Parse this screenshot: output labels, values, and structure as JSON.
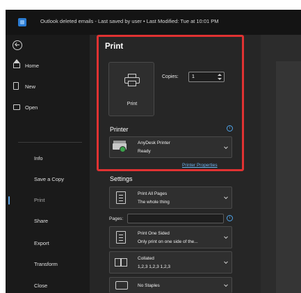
{
  "titlebar": {
    "title": "Outlook deleted emails  -  Last saved by user  •  Last Modified: Tue at 10:01 PM"
  },
  "sidebar": {
    "primary": [
      {
        "label": "Home",
        "icon": "home-icon"
      },
      {
        "label": "New",
        "icon": "new-document-icon"
      },
      {
        "label": "Open",
        "icon": "open-folder-icon"
      }
    ],
    "secondary": [
      {
        "label": "Info"
      },
      {
        "label": "Save a Copy"
      },
      {
        "label": "Print",
        "active": true
      },
      {
        "label": "Share"
      },
      {
        "label": "Export"
      },
      {
        "label": "Transform"
      },
      {
        "label": "Close"
      }
    ]
  },
  "print": {
    "heading": "Print",
    "button_label": "Print",
    "copies_label": "Copies:",
    "copies_value": "1"
  },
  "printer": {
    "section_title": "Printer",
    "name": "AnyDesk Printer",
    "status": "Ready",
    "properties_link": "Printer Properties"
  },
  "settings": {
    "section_title": "Settings",
    "pages_label": "Pages:",
    "pages_value": "",
    "options": [
      {
        "line1": "Print All Pages",
        "line2": "The whole thing",
        "icon": "pages-icon"
      },
      {
        "line1": "Print One Sided",
        "line2": "Only print on one side of the...",
        "icon": "one-sided-icon"
      },
      {
        "line1": "Collated",
        "line2": "1,2,3    1,2,3    1,2,3",
        "icon": "collate-icon"
      },
      {
        "line1": "No Staples",
        "line2": "",
        "icon": "staple-icon"
      }
    ]
  },
  "colors": {
    "highlight": "#e03232",
    "accent": "#4fa3e8",
    "background": "#1f1f1f"
  }
}
